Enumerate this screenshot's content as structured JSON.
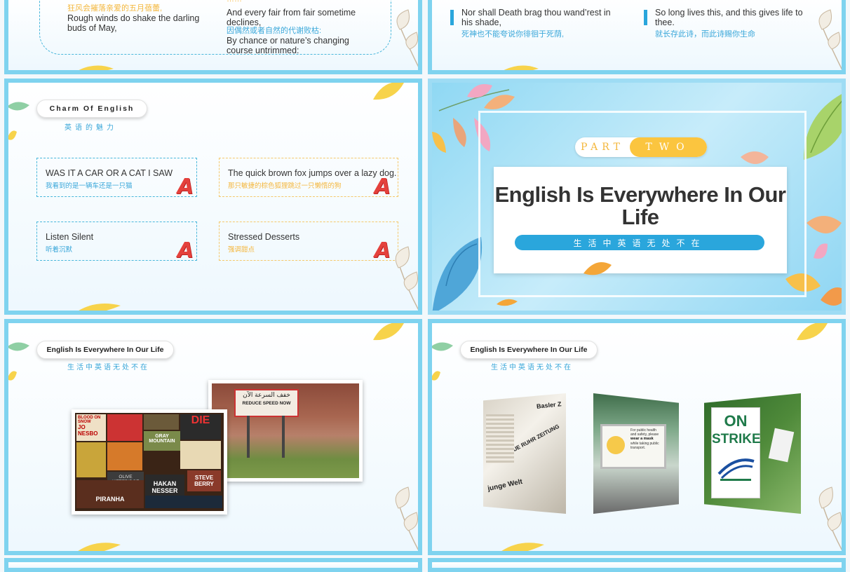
{
  "slide1": {
    "col1": {
      "cn1": "狂风会摧落亲爱的五月蓓蕾,",
      "en1": "Rough winds do shake the darling buds of May,"
    },
    "col2": {
      "cn0": "……",
      "en1": "And every fair from fair sometime declines,",
      "cn1": "因偶然或者自然的代谢败枯:",
      "en2": "By chance or nature’s changing course untrimmed:"
    }
  },
  "slide2": {
    "item1": {
      "en": "Nor shall Death brag thou wand’rest in his shade,",
      "cn": "死神也不能夸说你徘徊于死荫,"
    },
    "item2": {
      "en": "So long lives this, and this gives life to thee.",
      "cn": "就长存此诗，而此诗赐你生命"
    }
  },
  "slide3": {
    "pill": "Charm Of English",
    "subtitle": "英语的魅力",
    "boxes": [
      {
        "en": "WAS IT A CAR OR A CAT I SAW",
        "cn": "我看到的是一辆车还是一只猫",
        "mark": "A"
      },
      {
        "en": "The quick brown fox jumps over a lazy dog.",
        "cn": "那只敏捷的棕色狐狸跳过一只懒惰的狗",
        "mark": "A"
      },
      {
        "en": "Listen Silent",
        "cn": "听着沉默",
        "mark": "A"
      },
      {
        "en": "Stressed Desserts",
        "cn": "强调甜点",
        "mark": "A"
      }
    ]
  },
  "slide4": {
    "part_left": "PART",
    "part_right": "TWO",
    "title": "English Is Everywhere In Our Life",
    "subtitle": "生活中英语无处不在"
  },
  "slide5": {
    "pill": "English Is Everywhere In Our Life",
    "subtitle": "生活中英语无处不在",
    "photo_books": {
      "b1": "BLOOD ON SNOW",
      "b2": "JO NESBO",
      "b3": "DIE",
      "b4": "GRAY MOUNTAIN",
      "b5": "OLIVE KITTERIDGE",
      "b6": "HAKAN NESSER",
      "b7": "STEVE BERRY",
      "b8": "PIRANHA"
    },
    "photo_sign": {
      "arabic": "خفف السرعة الآن",
      "en": "REDUCE SPEED NOW"
    }
  },
  "slide6": {
    "pill": "English Is Everywhere In Our Life",
    "subtitle": "生活中英语无处不在",
    "photo_papers": {
      "p1": "Basler Z",
      "p2": "NEUE RUHR ZEITUNG",
      "p3": "junge Welt"
    },
    "photo_mask": {
      "line1": "For public health and safety, please",
      "line2": "wear a mask",
      "line3": "while taking public transport."
    },
    "photo_strike": {
      "line1": "ON",
      "line2": "STRIKE"
    }
  },
  "colors": {
    "frame": "#7fd3ef",
    "accent_blue": "#2aa6dc",
    "accent_orange": "#f4b73d",
    "mark_red": "#e4413c"
  }
}
